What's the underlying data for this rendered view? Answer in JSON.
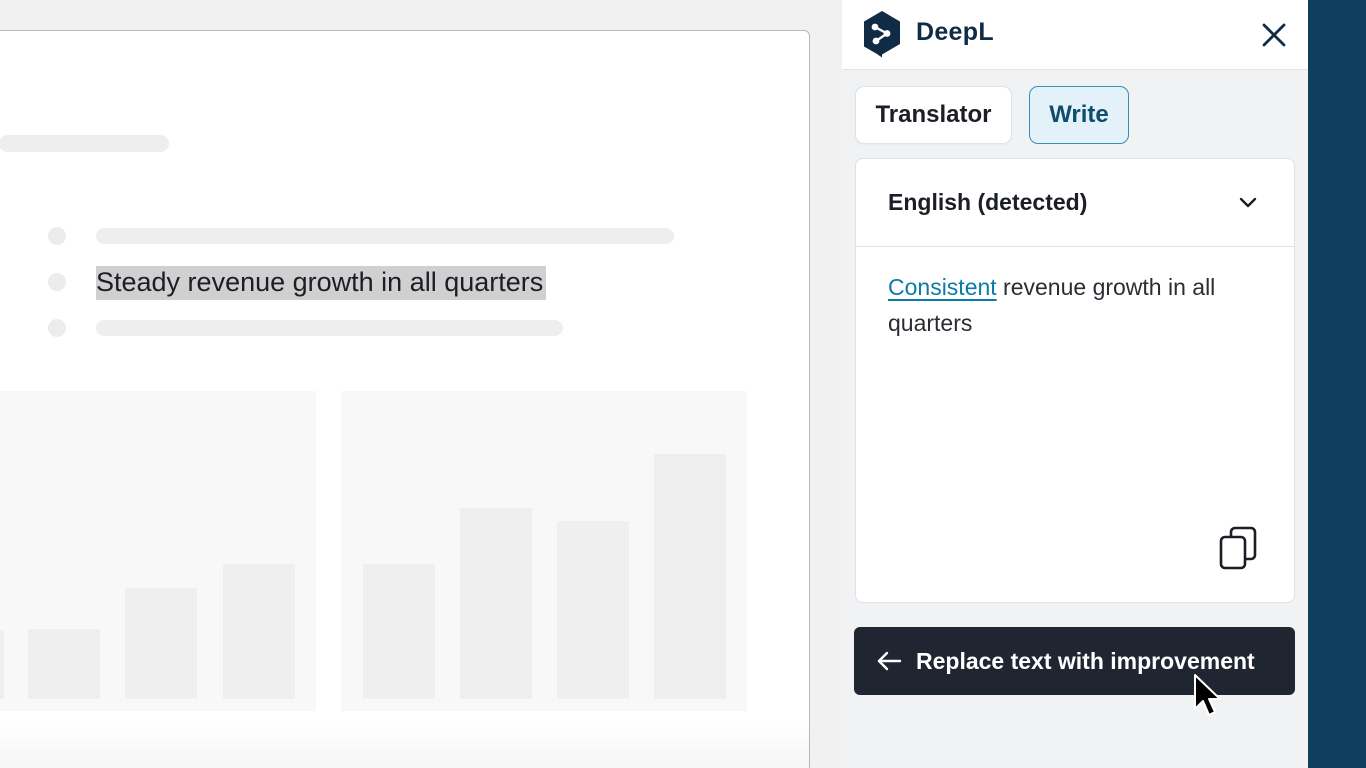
{
  "document": {
    "selected_text": "Steady revenue growth in all quarters"
  },
  "panel": {
    "brand": "DeepL",
    "tabs": {
      "translator": "Translator",
      "write": "Write",
      "active": "write"
    },
    "language": "English (detected)",
    "result": {
      "suggestion": "Consistent",
      "rest": " revenue growth in all quarters"
    },
    "replace_button_label": "Replace text with improvement"
  },
  "colors": {
    "brand_navy": "#0f2b46",
    "accent_blue": "#0d7aa8",
    "write_tab_bg": "#e3f2f8",
    "button_dark": "#1f2632",
    "side_strip": "#0f3e5e"
  }
}
